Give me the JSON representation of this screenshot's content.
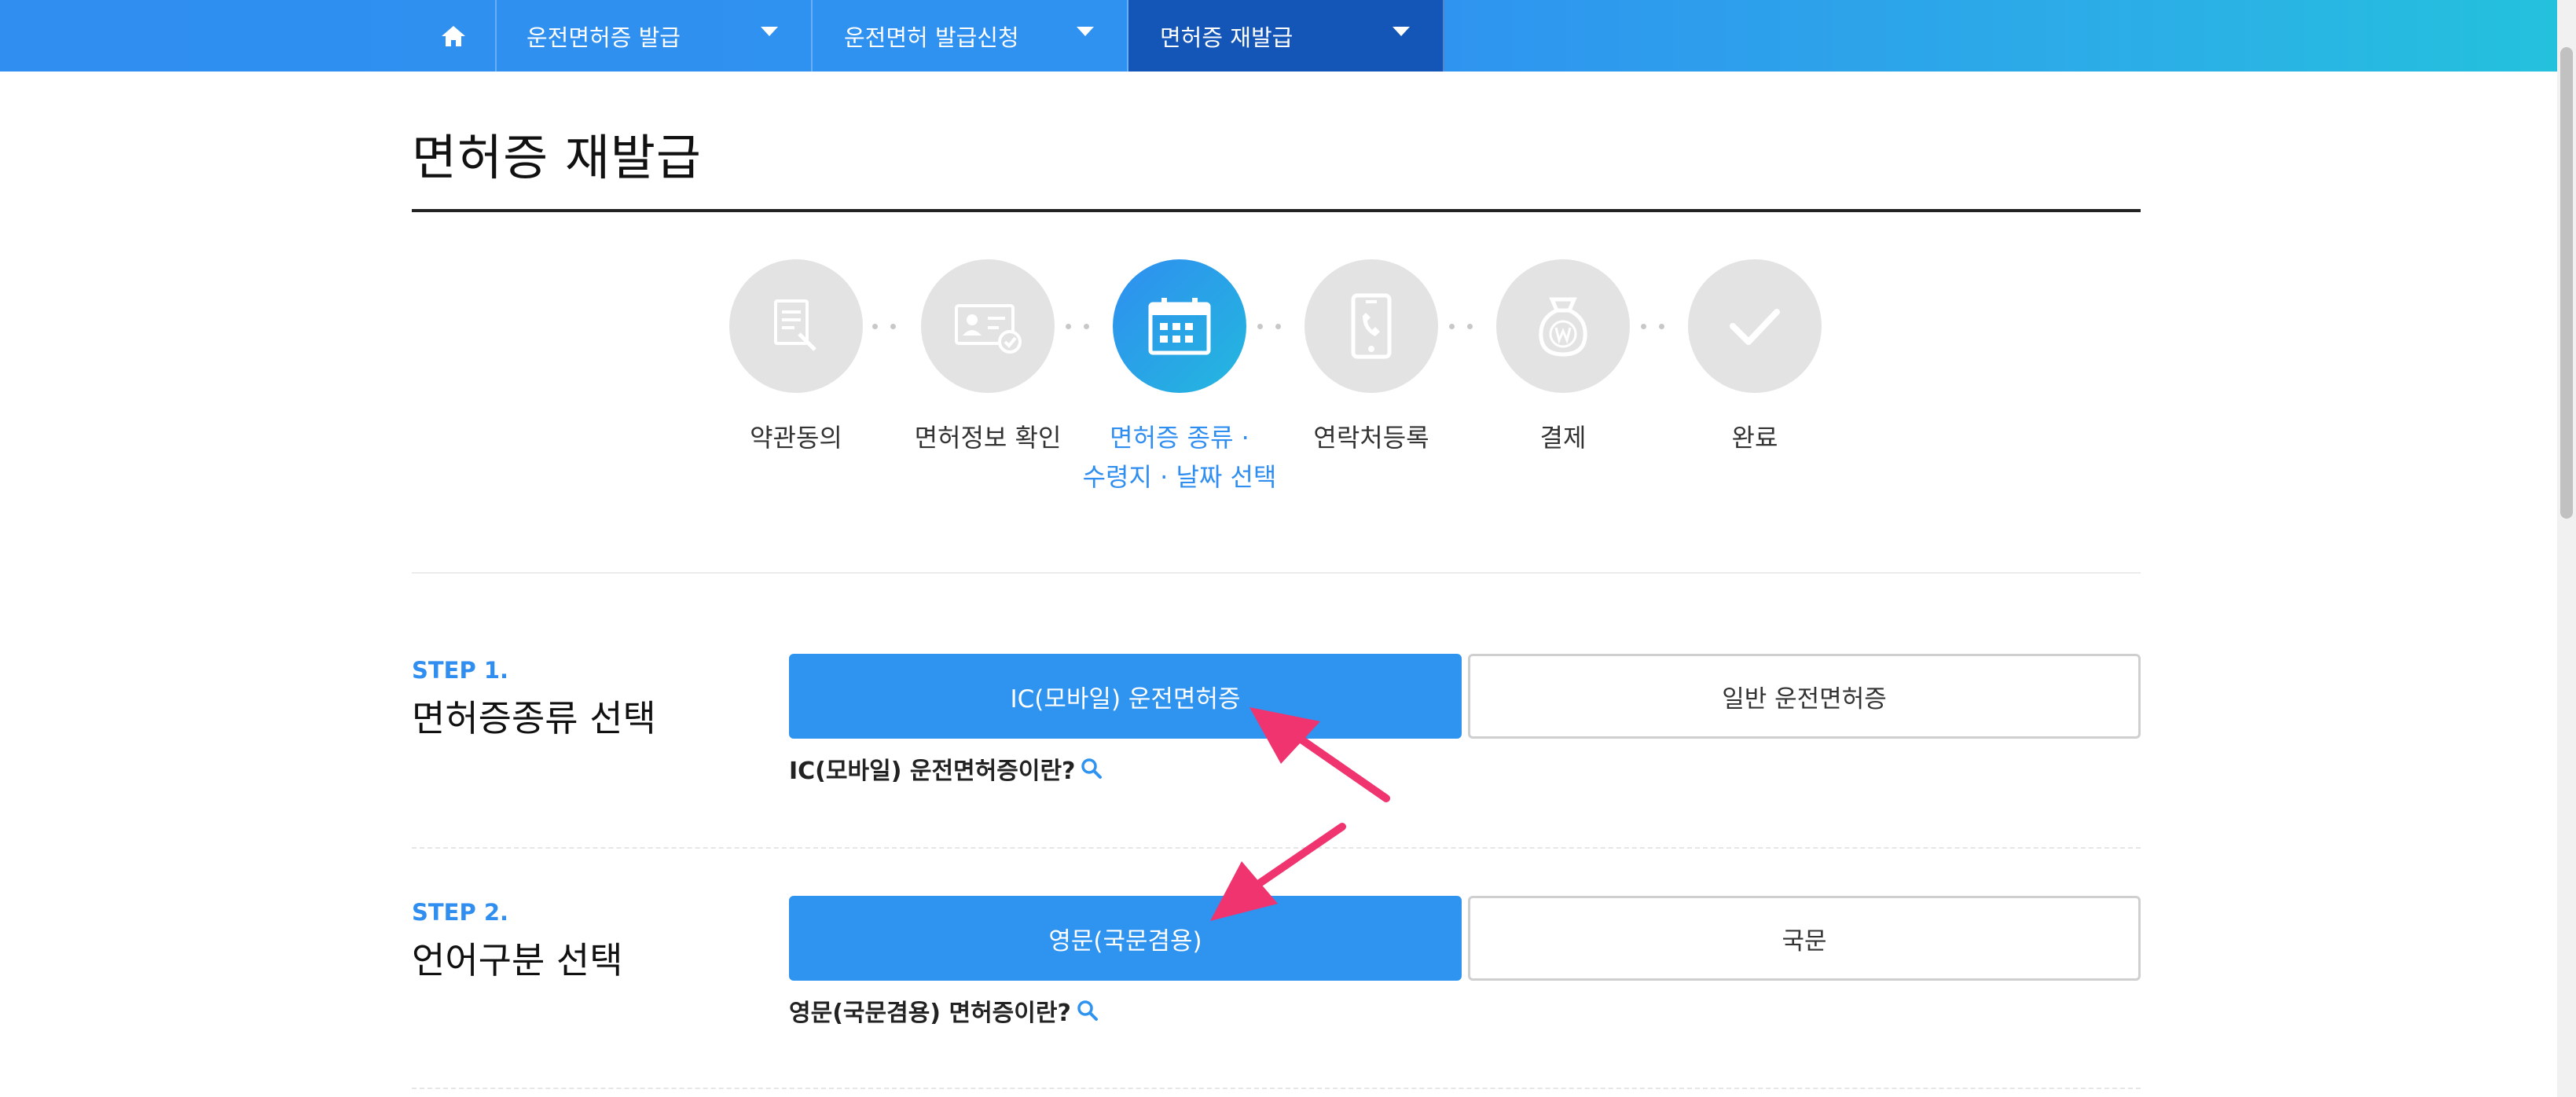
{
  "nav": {
    "home_icon": "home-icon",
    "items": [
      {
        "label": "운전면허증 발급"
      },
      {
        "label": "운전면허 발급신청"
      },
      {
        "label": "면허증 재발급",
        "active": true
      }
    ]
  },
  "page": {
    "title": "면허증 재발급"
  },
  "progress": {
    "steps": [
      {
        "icon": "document-pen-icon",
        "label": "약관동의"
      },
      {
        "icon": "id-card-check-icon",
        "label": "면허정보 확인"
      },
      {
        "icon": "calendar-icon",
        "label_line1": "면허증 종류 ·",
        "label_line2": "수령지 · 날짜 선택",
        "active": true
      },
      {
        "icon": "phone-icon",
        "label": "연락처등록"
      },
      {
        "icon": "won-bag-icon",
        "label": "결제"
      },
      {
        "icon": "check-icon",
        "label": "완료"
      }
    ]
  },
  "step1": {
    "tag": "STEP 1.",
    "heading": "면허증종류 선택",
    "option_selected": "IC(모바일) 운전면허증",
    "option_other": "일반 운전면허증",
    "info_link": "IC(모바일) 운전면허증이란?"
  },
  "step2": {
    "tag": "STEP 2.",
    "heading": "언어구분 선택",
    "option_selected": "영문(국문겸용)",
    "option_other": "국문",
    "info_link": "영문(국문겸용) 면허증이란?"
  },
  "colors": {
    "primary": "#2f93f0",
    "nav_active": "#1456b8",
    "annotation_arrow": "#f0346f",
    "inactive_step": "#e3e3e3"
  }
}
